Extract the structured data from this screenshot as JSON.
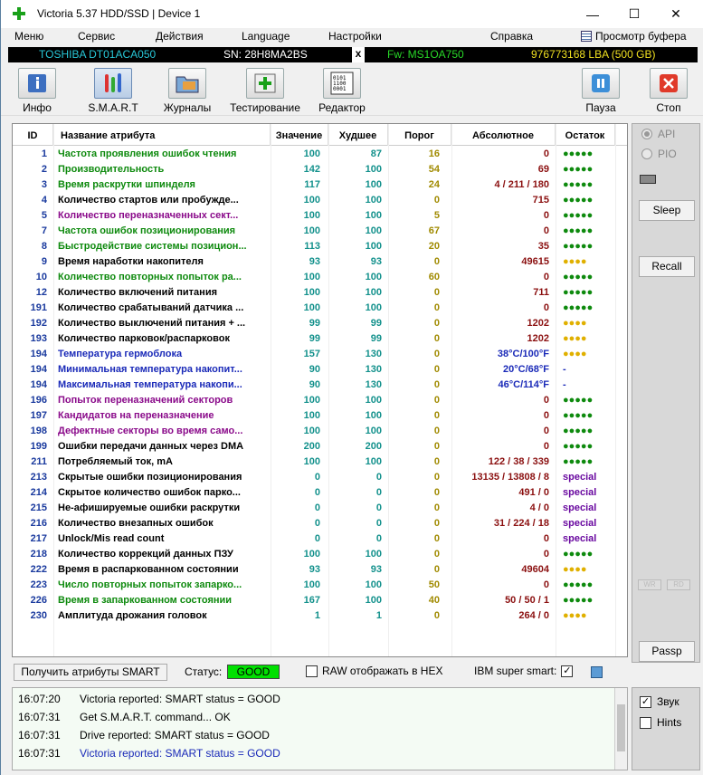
{
  "window": {
    "title": "Victoria 5.37 HDD/SSD | Device 1",
    "minimize": "—",
    "maximize": "☐",
    "close": "✕"
  },
  "menu": {
    "items": [
      "Меню",
      "Сервис",
      "Действия",
      "Language",
      "Настройки",
      "Справка"
    ],
    "buffer_view": "Просмотр буфера"
  },
  "drive": {
    "model": "TOSHIBA DT01ACA050",
    "serial": "SN: 28H8MA2BS",
    "x": "x",
    "firmware": "Fw: MS1OA750",
    "lba": "976773168 LBA (500 GB)"
  },
  "toolbar": {
    "info": "Инфо",
    "smart": "S.M.A.R.T",
    "logs": "Журналы",
    "testing": "Тестирование",
    "editor": "Редактор",
    "pause": "Пауза",
    "stop": "Стоп"
  },
  "table": {
    "headers": {
      "id": "ID",
      "name": "Название атрибута",
      "value": "Значение",
      "worst": "Худшее",
      "threshold": "Порог",
      "raw": "Абсолютное",
      "remaining": "Остаток"
    },
    "rows": [
      {
        "id": "1",
        "name": "Частота проявления ошибок чтения",
        "value": "100",
        "worst": "87",
        "thr": "16",
        "raw": "0",
        "rem": "●●●●●",
        "nc": "n-green",
        "rc": "r-green"
      },
      {
        "id": "2",
        "name": "Производительность",
        "value": "142",
        "worst": "100",
        "thr": "54",
        "raw": "69",
        "rem": "●●●●●",
        "nc": "n-green",
        "rc": "r-green"
      },
      {
        "id": "3",
        "name": "Время раскрутки шпинделя",
        "value": "117",
        "worst": "100",
        "thr": "24",
        "raw": "4 / 211 / 180",
        "rem": "●●●●●",
        "nc": "n-green",
        "rc": "r-green"
      },
      {
        "id": "4",
        "name": "Количество стартов или пробужде...",
        "value": "100",
        "worst": "100",
        "thr": "0",
        "raw": "715",
        "rem": "●●●●●",
        "nc": "n-black",
        "rc": "r-green"
      },
      {
        "id": "5",
        "name": "Количество переназначенных сект...",
        "value": "100",
        "worst": "100",
        "thr": "5",
        "raw": "0",
        "rem": "●●●●●",
        "nc": "n-purple",
        "rc": "r-green"
      },
      {
        "id": "7",
        "name": "Частота ошибок позиционирования",
        "value": "100",
        "worst": "100",
        "thr": "67",
        "raw": "0",
        "rem": "●●●●●",
        "nc": "n-green",
        "rc": "r-green"
      },
      {
        "id": "8",
        "name": "Быстродействие системы позицион...",
        "value": "113",
        "worst": "100",
        "thr": "20",
        "raw": "35",
        "rem": "●●●●●",
        "nc": "n-green",
        "rc": "r-green"
      },
      {
        "id": "9",
        "name": "Время наработки накопителя",
        "value": "93",
        "worst": "93",
        "thr": "0",
        "raw": "49615",
        "rem": "●●●●",
        "nc": "n-black",
        "rc": "r-yellow"
      },
      {
        "id": "10",
        "name": "Количество повторных попыток ра...",
        "value": "100",
        "worst": "100",
        "thr": "60",
        "raw": "0",
        "rem": "●●●●●",
        "nc": "n-green",
        "rc": "r-green"
      },
      {
        "id": "12",
        "name": "Количество включений питания",
        "value": "100",
        "worst": "100",
        "thr": "0",
        "raw": "711",
        "rem": "●●●●●",
        "nc": "n-black",
        "rc": "r-green"
      },
      {
        "id": "191",
        "name": "Количество срабатываний датчика ...",
        "value": "100",
        "worst": "100",
        "thr": "0",
        "raw": "0",
        "rem": "●●●●●",
        "nc": "n-black",
        "rc": "r-green"
      },
      {
        "id": "192",
        "name": "Количество выключений питания + ...",
        "value": "99",
        "worst": "99",
        "thr": "0",
        "raw": "1202",
        "rem": "●●●●",
        "nc": "n-black",
        "rc": "r-yellow"
      },
      {
        "id": "193",
        "name": "Количество парковок/распарковок",
        "value": "99",
        "worst": "99",
        "thr": "0",
        "raw": "1202",
        "rem": "●●●●",
        "nc": "n-black",
        "rc": "r-yellow"
      },
      {
        "id": "194",
        "name": "Температура гермоблока",
        "value": "157",
        "worst": "130",
        "thr": "0",
        "raw": "38°C/100°F",
        "rem": "●●●●",
        "nc": "n-blue",
        "rc": "r-yellow",
        "rawc": "raw-blue"
      },
      {
        "id": "194",
        "name": "Минимальная температура накопит...",
        "value": "90",
        "worst": "130",
        "thr": "0",
        "raw": "20°C/68°F",
        "rem": "-",
        "nc": "n-blue",
        "rc": "r-blue",
        "rawc": "raw-blue"
      },
      {
        "id": "194",
        "name": "Максимальная температура накопи...",
        "value": "90",
        "worst": "130",
        "thr": "0",
        "raw": "46°C/114°F",
        "rem": "-",
        "nc": "n-blue",
        "rc": "r-blue",
        "rawc": "raw-blue"
      },
      {
        "id": "196",
        "name": "Попыток переназначений секторов",
        "value": "100",
        "worst": "100",
        "thr": "0",
        "raw": "0",
        "rem": "●●●●●",
        "nc": "n-purple",
        "rc": "r-green"
      },
      {
        "id": "197",
        "name": "Кандидатов на переназначение",
        "value": "100",
        "worst": "100",
        "thr": "0",
        "raw": "0",
        "rem": "●●●●●",
        "nc": "n-purple",
        "rc": "r-green"
      },
      {
        "id": "198",
        "name": "Дефектные секторы во время само...",
        "value": "100",
        "worst": "100",
        "thr": "0",
        "raw": "0",
        "rem": "●●●●●",
        "nc": "n-purple",
        "rc": "r-green"
      },
      {
        "id": "199",
        "name": "Ошибки передачи данных через DMA",
        "value": "200",
        "worst": "200",
        "thr": "0",
        "raw": "0",
        "rem": "●●●●●",
        "nc": "n-black",
        "rc": "r-green"
      },
      {
        "id": "211",
        "name": "Потребляемый ток, mA",
        "value": "100",
        "worst": "100",
        "thr": "0",
        "raw": "122 / 38 / 339",
        "rem": "●●●●●",
        "nc": "n-black",
        "rc": "r-green"
      },
      {
        "id": "213",
        "name": "Скрытые ошибки позиционирования",
        "value": "0",
        "worst": "0",
        "thr": "0",
        "raw": "13135 / 13808 / 8",
        "rem": "special",
        "nc": "n-black",
        "rc": "r-purple"
      },
      {
        "id": "214",
        "name": "Скрытое количество ошибок парко...",
        "value": "0",
        "worst": "0",
        "thr": "0",
        "raw": "491 / 0",
        "rem": "special",
        "nc": "n-black",
        "rc": "r-purple"
      },
      {
        "id": "215",
        "name": "Не-афишируемые ошибки раскрутки",
        "value": "0",
        "worst": "0",
        "thr": "0",
        "raw": "4 / 0",
        "rem": "special",
        "nc": "n-black",
        "rc": "r-purple"
      },
      {
        "id": "216",
        "name": "Количество внезапных ошибок",
        "value": "0",
        "worst": "0",
        "thr": "0",
        "raw": "31 / 224 / 18",
        "rem": "special",
        "nc": "n-black",
        "rc": "r-purple"
      },
      {
        "id": "217",
        "name": "Unlock/Mis read count",
        "value": "0",
        "worst": "0",
        "thr": "0",
        "raw": "0",
        "rem": "special",
        "nc": "n-black",
        "rc": "r-purple"
      },
      {
        "id": "218",
        "name": "Количество коррекций данных ПЗУ",
        "value": "100",
        "worst": "100",
        "thr": "0",
        "raw": "0",
        "rem": "●●●●●",
        "nc": "n-black",
        "rc": "r-green"
      },
      {
        "id": "222",
        "name": "Время в распаркованном состоянии",
        "value": "93",
        "worst": "93",
        "thr": "0",
        "raw": "49604",
        "rem": "●●●●",
        "nc": "n-black",
        "rc": "r-yellow"
      },
      {
        "id": "223",
        "name": "Число повторных попыток запарко...",
        "value": "100",
        "worst": "100",
        "thr": "50",
        "raw": "0",
        "rem": "●●●●●",
        "nc": "n-green",
        "rc": "r-green"
      },
      {
        "id": "226",
        "name": "Время в запаркованном состоянии",
        "value": "167",
        "worst": "100",
        "thr": "40",
        "raw": "50 / 50 / 1",
        "rem": "●●●●●",
        "nc": "n-green",
        "rc": "r-green"
      },
      {
        "id": "230",
        "name": "Амплитуда дрожания головок",
        "value": "1",
        "worst": "1",
        "thr": "0",
        "raw": "264 / 0",
        "rem": "●●●●",
        "nc": "n-black",
        "rc": "r-yellow"
      }
    ]
  },
  "side": {
    "api": "API",
    "pio": "PIO",
    "sleep": "Sleep",
    "recall": "Recall",
    "wr": "WR",
    "rd": "RD",
    "passp": "Passp",
    "sound": "Звук",
    "hints": "Hints"
  },
  "status": {
    "get_smart": "Получить атрибуты SMART",
    "label": "Статус:",
    "value": "GOOD",
    "raw_hex": "RAW отображать в HEX",
    "ibm": "IBM super smart:",
    "ibm_check": "✓",
    "sound_check": "✓"
  },
  "log": [
    {
      "time": "16:07:20",
      "msg": "Victoria reported: SMART status = GOOD",
      "color": "#000"
    },
    {
      "time": "16:07:31",
      "msg": "Get S.M.A.R.T. command... OK",
      "color": "#000"
    },
    {
      "time": "16:07:31",
      "msg": "Drive reported: SMART status = GOOD",
      "color": "#000"
    },
    {
      "time": "16:07:31",
      "msg": "Victoria reported: SMART status = GOOD",
      "color": "#1a2ab8"
    }
  ]
}
